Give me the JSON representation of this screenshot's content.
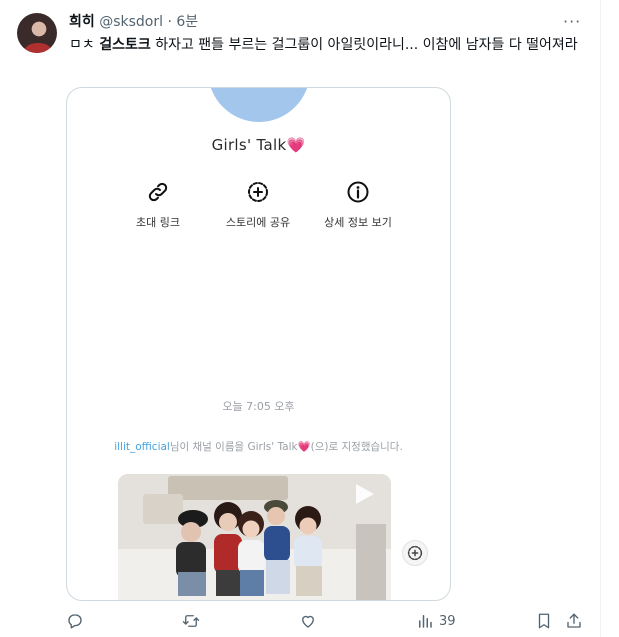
{
  "tweet": {
    "display_name": "희히",
    "handle": "@sksdorl",
    "separator": "·",
    "time": "6분",
    "more": "···",
    "text_prefix": "ㅁㅊ ",
    "text_bold": "걸스토크",
    "text_rest": " 하자고 팬들 부르는 걸그룹이 아일릿이라니... 이참에 남자들 다 떨어져라"
  },
  "card": {
    "channel_title": "Girls' Talk",
    "heart": "💗",
    "actions": [
      {
        "label": "초대 링크",
        "icon": "link-icon"
      },
      {
        "label": "스토리에 공유",
        "icon": "story-share-icon"
      },
      {
        "label": "상세 정보 보기",
        "icon": "info-icon"
      }
    ],
    "system_time": "오늘 7:05 오후",
    "notice_user": "illit_official",
    "notice_pre": "님이 채널 이름을 Girls' Talk",
    "notice_post": "(으)로 지정했습니다."
  },
  "actions": {
    "reply_icon": "reply-icon",
    "retweet_icon": "retweet-icon",
    "like_icon": "heart-icon",
    "views_icon": "views-icon",
    "views_count": "39",
    "bookmark_icon": "bookmark-icon",
    "share_icon": "share-icon"
  }
}
